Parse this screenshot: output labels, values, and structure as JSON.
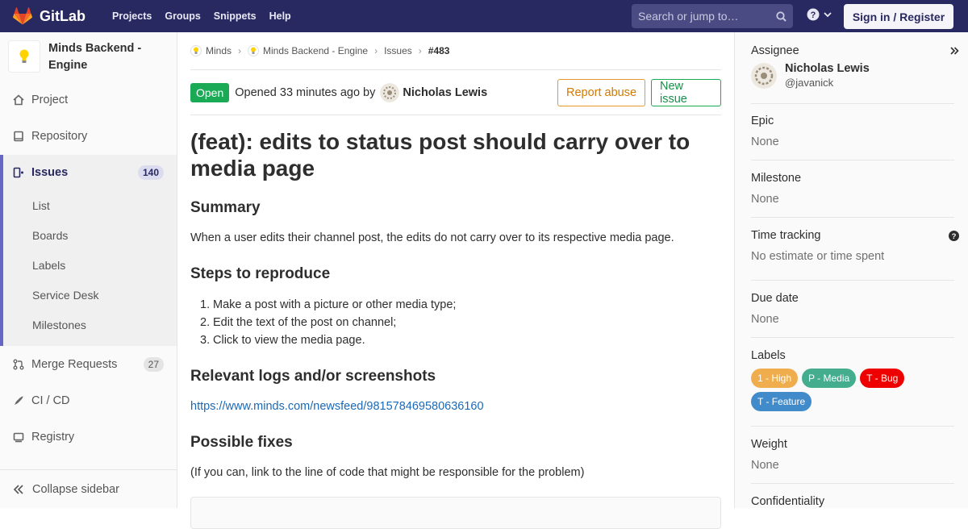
{
  "navbar": {
    "brand": "GitLab",
    "links": [
      "Projects",
      "Groups",
      "Snippets",
      "Help"
    ],
    "search_placeholder": "Search or jump to…",
    "signin_label": "Sign in / Register"
  },
  "sidebar": {
    "project_name": "Minds Backend - Engine",
    "items": {
      "project": "Project",
      "repository": "Repository",
      "issues": "Issues",
      "issues_count": "140",
      "merge_requests": "Merge Requests",
      "merge_requests_count": "27",
      "cicd": "CI / CD",
      "registry": "Registry"
    },
    "sub_items": [
      "List",
      "Boards",
      "Labels",
      "Service Desk",
      "Milestones"
    ],
    "collapse_label": "Collapse sidebar"
  },
  "breadcrumb": [
    "Minds",
    "Minds Backend - Engine",
    "Issues",
    "#483"
  ],
  "issue": {
    "status": "Open",
    "opened_text": "Opened 33 minutes ago by",
    "author": "Nicholas Lewis",
    "report_abuse": "Report abuse",
    "new_issue": "New issue",
    "title": "(feat): edits to status post should carry over to media page",
    "summary_heading": "Summary",
    "summary_text": "When a user edits their channel post, the edits do not carry over to its respective media page.",
    "steps_heading": "Steps to reproduce",
    "steps": [
      "Make a post with a picture or other media type;",
      "Edit the text of the post on channel;",
      "Click to view the media page."
    ],
    "logs_heading": "Relevant logs and/or screenshots",
    "logs_link": "https://www.minds.com/newsfeed/981578469580636160",
    "fixes_heading": "Possible fixes",
    "fixes_text": "(If you can, link to the line of code that might be responsible for the problem)"
  },
  "right_sidebar": {
    "assignee_label": "Assignee",
    "assignee_name": "Nicholas Lewis",
    "assignee_username": "@javanick",
    "epic_label": "Epic",
    "epic_value": "None",
    "milestone_label": "Milestone",
    "milestone_value": "None",
    "time_label": "Time tracking",
    "time_value": "No estimate or time spent",
    "due_label": "Due date",
    "due_value": "None",
    "labels_label": "Labels",
    "labels": [
      {
        "text": "1 - High",
        "color": "#f0ad4e"
      },
      {
        "text": "P - Media",
        "color": "#44ad8e"
      },
      {
        "text": "T - Bug",
        "color": "#ee0000"
      },
      {
        "text": "T - Feature",
        "color": "#428bca"
      }
    ],
    "weight_label": "Weight",
    "weight_value": "None",
    "confidentiality_label": "Confidentiality"
  }
}
